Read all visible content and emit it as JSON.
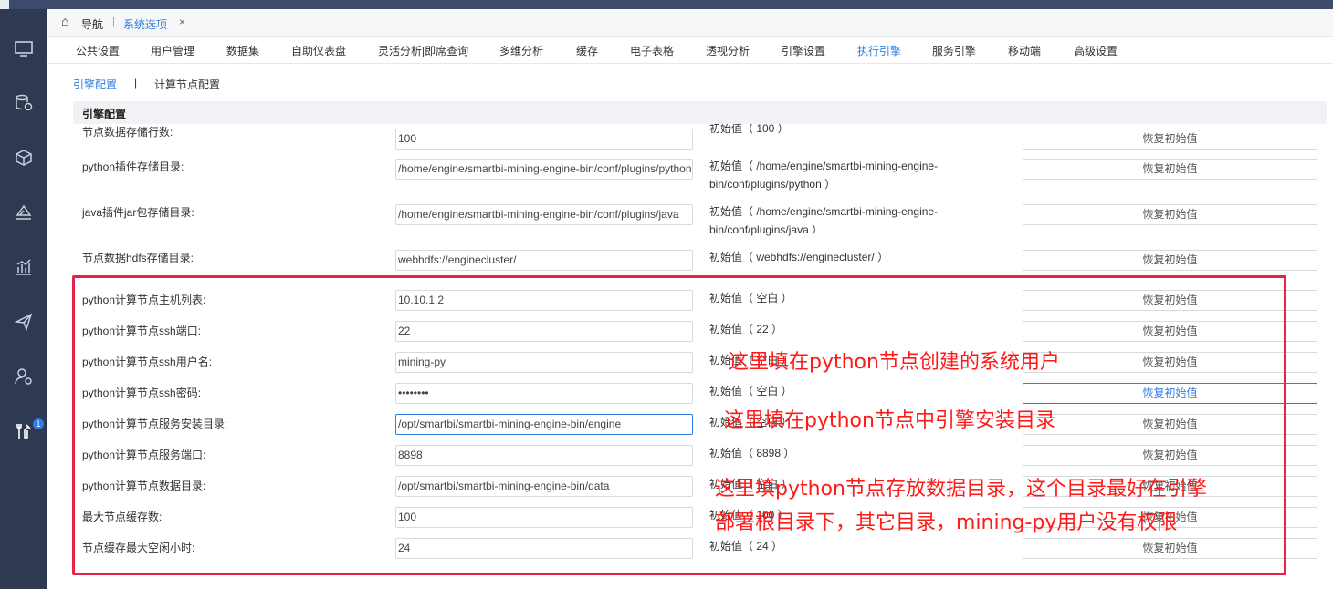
{
  "nav": {
    "home_label": "导航",
    "separator": "|",
    "tab_title": "系统选项",
    "tab_close": "×"
  },
  "tabs": [
    "公共设置",
    "用户管理",
    "数据集",
    "自助仪表盘",
    "灵活分析|即席查询",
    "多维分析",
    "缓存",
    "电子表格",
    "透视分析",
    "引擎设置",
    "执行引擎",
    "服务引擎",
    "移动端",
    "高级设置"
  ],
  "active_tab": "执行引擎",
  "subtabs": {
    "first": "引擎配置",
    "separator": "|",
    "second": "计算节点配置"
  },
  "section_title": "引擎配置",
  "rows": [
    {
      "label": "节点数据存储行数:",
      "value": "100",
      "initial": "初始值（ 100 ）",
      "button": "恢复初始值"
    },
    {
      "label": "python插件存储目录:",
      "value": "/home/engine/smartbi-mining-engine-bin/conf/plugins/python",
      "initial": "初始值（ /home/engine/smartbi-mining-engine-bin/conf/plugins/python ）",
      "button": "恢复初始值"
    },
    {
      "label": "java插件jar包存储目录:",
      "value": "/home/engine/smartbi-mining-engine-bin/conf/plugins/java",
      "initial": "初始值（ /home/engine/smartbi-mining-engine-bin/conf/plugins/java ）",
      "button": "恢复初始值"
    },
    {
      "label": "节点数据hdfs存储目录:",
      "value": "webhdfs://enginecluster/",
      "initial": "初始值（ webhdfs://enginecluster/ ）",
      "button": "恢复初始值"
    },
    {
      "label": "python计算节点主机列表:",
      "value": "10.10.1.2",
      "initial": "初始值（ 空白 ）",
      "button": "恢复初始值"
    },
    {
      "label": "python计算节点ssh端口:",
      "value": "22",
      "initial": "初始值（ 22 ）",
      "button": "恢复初始值"
    },
    {
      "label": "python计算节点ssh用户名:",
      "value": "mining-py",
      "initial": "初始值（ 空白 ）",
      "button": "恢复初始值"
    },
    {
      "label": "python计算节点ssh密码:",
      "value": "••••••••",
      "initial": "初始值（ 空白 ）",
      "button": "恢复初始值"
    },
    {
      "label": "python计算节点服务安装目录:",
      "value": "/opt/smartbi/smartbi-mining-engine-bin/engine",
      "initial": "初始值（ 空白 ）",
      "button": "恢复初始值"
    },
    {
      "label": "python计算节点服务端口:",
      "value": "8898",
      "initial": "初始值（ 8898 ）",
      "button": "恢复初始值"
    },
    {
      "label": "python计算节点数据目录:",
      "value": "/opt/smartbi/smartbi-mining-engine-bin/data",
      "initial": "初始值（ 空白 ）",
      "button": "恢复初始值"
    },
    {
      "label": "最大节点缓存数:",
      "value": "100",
      "initial": "初始值（ 100 ）",
      "button": "恢复初始值"
    },
    {
      "label": "节点缓存最大空闲小时:",
      "value": "24",
      "initial": "初始值（ 24 ）",
      "button": "恢复初始值"
    }
  ],
  "annotations": [
    "这里填在python节点创建的系统用户",
    "这里填在python节点中引擎安装目录",
    "这里填python节点存放数据目录，这个目录最好在引擎",
    "部署根目录下，其它目录，mining-py用户没有权限"
  ],
  "sidebar": {
    "badge_count": "1"
  },
  "colors": {
    "sidebar": "#2f3a52",
    "accent": "#2f7de1",
    "annotation": "#ff1a1a",
    "highlight_box": "#e8234a"
  }
}
